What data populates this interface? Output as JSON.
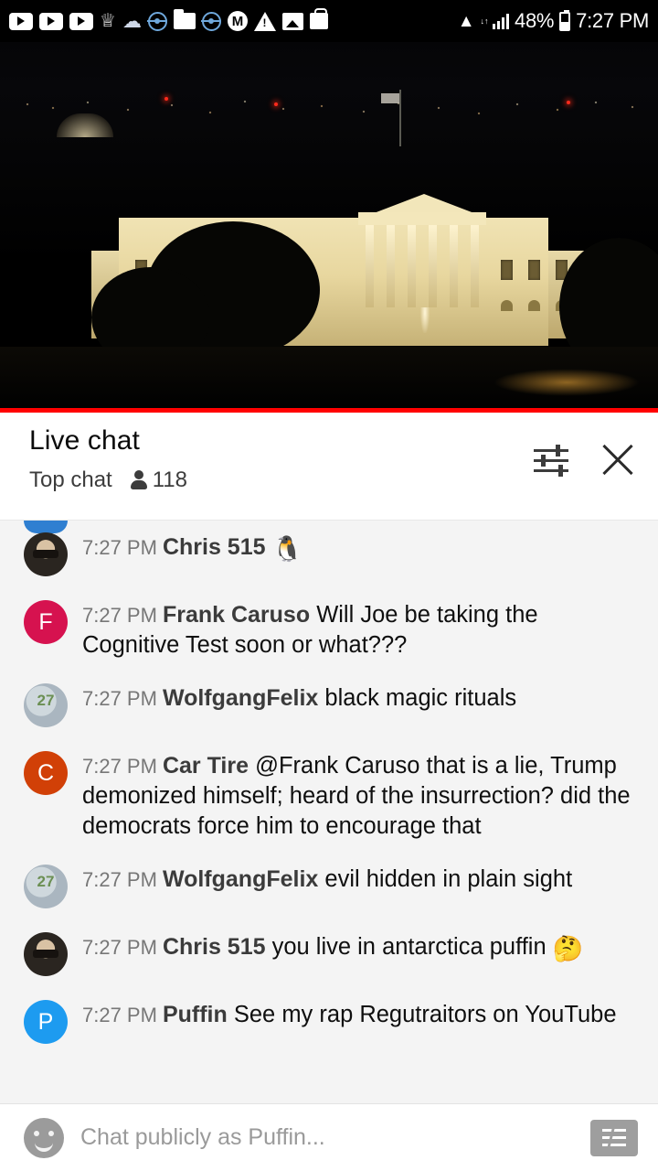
{
  "status_bar": {
    "icons": [
      "youtube-icon",
      "youtube-icon",
      "youtube-icon",
      "crown-icon",
      "cloud-icon",
      "pokeball-icon",
      "folder-icon",
      "pokeball-icon",
      "circle-m-icon",
      "warning-icon",
      "photo-icon",
      "bag-icon"
    ],
    "circle_m_label": "M",
    "wifi_icon": "wifi-icon",
    "signal_icon": "signal-bars-icon",
    "data_arrows": "↓↑",
    "battery_percent": "48%",
    "battery_icon": "battery-icon",
    "clock": "7:27 PM"
  },
  "video": {
    "name": "white-house-night-live-stream",
    "progress_color": "#ff0000",
    "progress_percent": 100
  },
  "chat_header": {
    "title": "Live chat",
    "mode": "Top chat",
    "viewer_icon": "person-icon",
    "viewer_count": "118",
    "settings_icon": "chat-settings-sliders-icon",
    "close_icon": "close-icon"
  },
  "messages": [
    {
      "avatar_type": "photo",
      "avatar_class": "photo-chris",
      "avatar_letter": "",
      "avatar_color": "#2a2520",
      "time": "7:27 PM",
      "author": "Chris 515",
      "text": "",
      "emoji": "🐧"
    },
    {
      "avatar_type": "letter",
      "avatar_class": "",
      "avatar_letter": "F",
      "avatar_color": "#d6124f",
      "time": "7:27 PM",
      "author": "Frank Caruso",
      "text": "Will Joe be taking the Cognitive Test soon or what???",
      "emoji": ""
    },
    {
      "avatar_type": "photo",
      "avatar_class": "photo-wolf",
      "avatar_letter": "",
      "avatar_color": "#aab6c0",
      "time": "7:27 PM",
      "author": "WolfgangFelix",
      "text": "black magic rituals",
      "emoji": ""
    },
    {
      "avatar_type": "letter",
      "avatar_class": "",
      "avatar_letter": "C",
      "avatar_color": "#d14007",
      "time": "7:27 PM",
      "author": "Car Tire",
      "text": "@Frank Caruso that is a lie, Trump demonized himself; heard of the insurrection? did the democrats force him to encourage that",
      "emoji": ""
    },
    {
      "avatar_type": "photo",
      "avatar_class": "photo-wolf",
      "avatar_letter": "",
      "avatar_color": "#aab6c0",
      "time": "7:27 PM",
      "author": "WolfgangFelix",
      "text": "evil hidden in plain sight",
      "emoji": ""
    },
    {
      "avatar_type": "photo",
      "avatar_class": "photo-chris",
      "avatar_letter": "",
      "avatar_color": "#2a2520",
      "time": "7:27 PM",
      "author": "Chris 515",
      "text": "you live in antarctica puffin",
      "emoji": "🤔"
    },
    {
      "avatar_type": "letter",
      "avatar_class": "",
      "avatar_letter": "P",
      "avatar_color": "#1d9bf0",
      "time": "7:27 PM",
      "author": "Puffin",
      "text": "See my rap Regutraitors on YouTube",
      "emoji": ""
    }
  ],
  "composer": {
    "emoji_icon": "smiley-icon",
    "placeholder": "Chat publicly as Puffin...",
    "value": "",
    "superchat_icon": "super-chat-icon"
  }
}
